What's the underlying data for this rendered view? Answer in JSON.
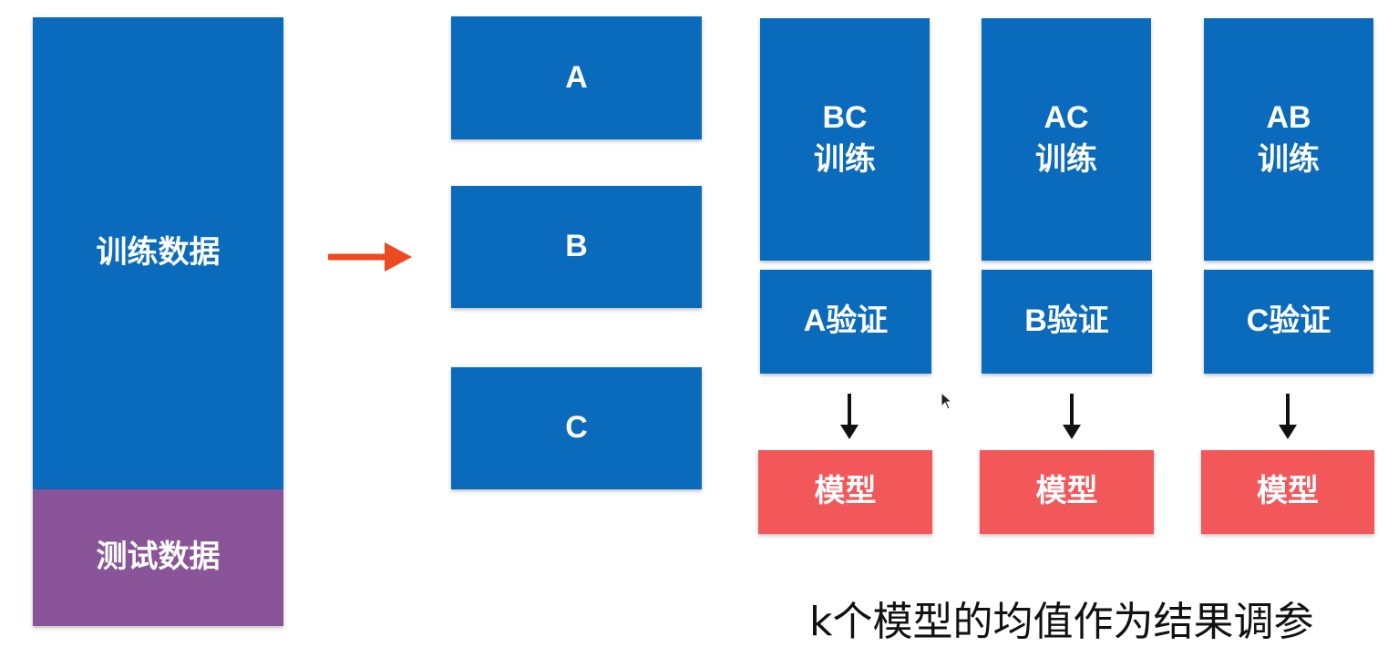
{
  "left_column": {
    "train_label": "训练数据",
    "test_label": "测试数据"
  },
  "folds": {
    "a": "A",
    "b": "B",
    "c": "C"
  },
  "columns": [
    {
      "train_top": "BC",
      "train_bottom": "训练",
      "validate": "A验证",
      "model": "模型"
    },
    {
      "train_top": "AC",
      "train_bottom": "训练",
      "validate": "B验证",
      "model": "模型"
    },
    {
      "train_top": "AB",
      "train_bottom": "训练",
      "validate": "C验证",
      "model": "模型"
    }
  ],
  "caption": "k个模型的均值作为结果调参",
  "colors": {
    "blue": "#0a6bbd",
    "purple": "#8a5499",
    "red": "#f2575a",
    "arrow_orange": "#ee4a21"
  }
}
